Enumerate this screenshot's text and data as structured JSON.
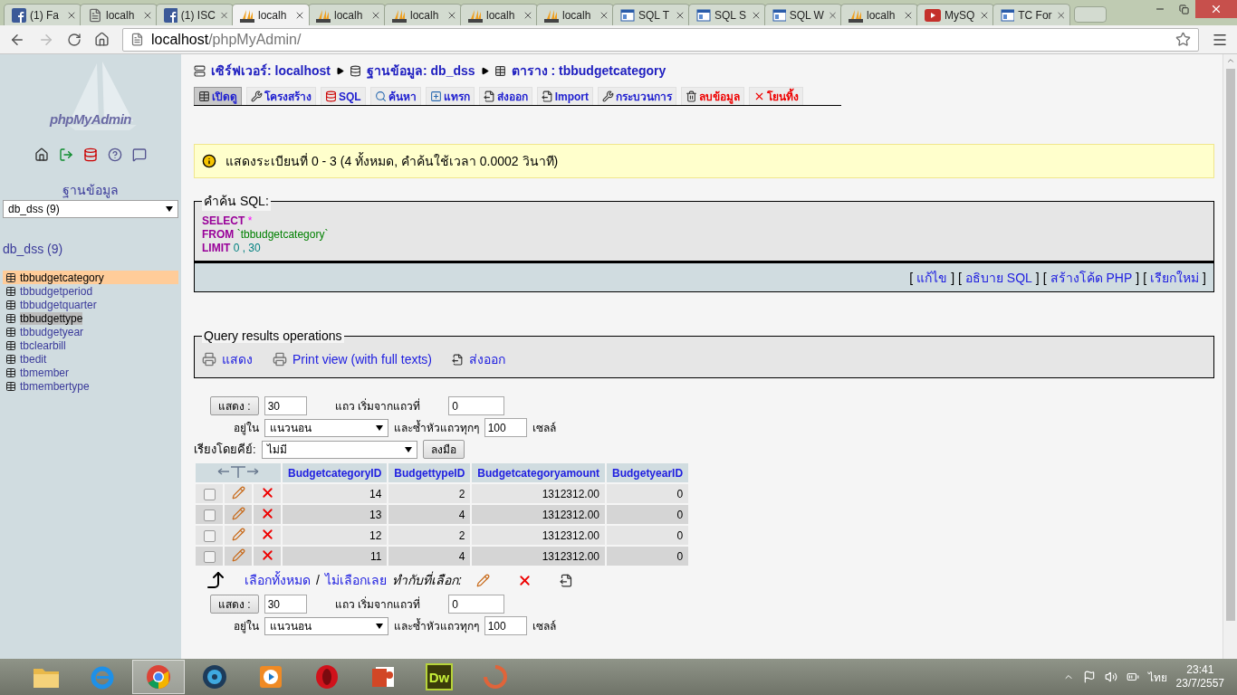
{
  "browser": {
    "tabs": [
      {
        "label": "(1) Fa",
        "kind": "facebook",
        "selected": false
      },
      {
        "label": "localh",
        "kind": "page",
        "selected": false
      },
      {
        "label": "(1) ISC",
        "kind": "facebook",
        "selected": false
      },
      {
        "label": "localh",
        "kind": "pma",
        "selected": true
      },
      {
        "label": "localh",
        "kind": "pma",
        "selected": false
      },
      {
        "label": "localh",
        "kind": "pma",
        "selected": false
      },
      {
        "label": "localh",
        "kind": "pma",
        "selected": false
      },
      {
        "label": "localh",
        "kind": "pma",
        "selected": false
      },
      {
        "label": "SQL T",
        "kind": "sql",
        "selected": false
      },
      {
        "label": "SQL S",
        "kind": "sql",
        "selected": false
      },
      {
        "label": "SQL W",
        "kind": "sql",
        "selected": false
      },
      {
        "label": "localh",
        "kind": "pma",
        "selected": false
      },
      {
        "label": "MySQ",
        "kind": "youtube",
        "selected": false
      },
      {
        "label": "TC For",
        "kind": "sql",
        "selected": false
      }
    ],
    "url_host": "localhost",
    "url_path": "/phpMyAdmin/"
  },
  "sidebar": {
    "logo": "phpMyAdmin",
    "db_label": "ฐานข้อมูล",
    "db_select": "db_dss (9)",
    "db_heading": "db_dss (9)",
    "tables": [
      {
        "name": "tbbudgetcategory",
        "selected": true,
        "hovered": false
      },
      {
        "name": "tbbudgetperiod",
        "selected": false,
        "hovered": false
      },
      {
        "name": "tbbudgetquarter",
        "selected": false,
        "hovered": false
      },
      {
        "name": "tbbudgettype",
        "selected": false,
        "hovered": true
      },
      {
        "name": "tbbudgetyear",
        "selected": false,
        "hovered": false
      },
      {
        "name": "tbclearbill",
        "selected": false,
        "hovered": false
      },
      {
        "name": "tbedit",
        "selected": false,
        "hovered": false
      },
      {
        "name": "tbmember",
        "selected": false,
        "hovered": false
      },
      {
        "name": "tbmembertype",
        "selected": false,
        "hovered": false
      }
    ]
  },
  "breadcrumb": [
    {
      "kind": "server",
      "label": "เซิร์ฟเวอร์: localhost"
    },
    {
      "kind": "database",
      "label": "ฐานข้อมูล: db_dss"
    },
    {
      "kind": "table",
      "label": "ตาราง : tbbudgetcategory"
    }
  ],
  "tabs": [
    {
      "label": "เปิดดู",
      "kind": "browse",
      "selected": true
    },
    {
      "label": "โครงสร้าง",
      "kind": "structure",
      "selected": false
    },
    {
      "label": "SQL",
      "kind": "sql",
      "selected": false
    },
    {
      "label": "ค้นหา",
      "kind": "search",
      "selected": false
    },
    {
      "label": "แทรก",
      "kind": "insert",
      "selected": false
    },
    {
      "label": "ส่งออก",
      "kind": "export",
      "selected": false
    },
    {
      "label": "Import",
      "kind": "import",
      "selected": false
    },
    {
      "label": "กระบวนการ",
      "kind": "tools",
      "selected": false
    },
    {
      "label": "ลบข้อมูล",
      "kind": "empty",
      "selected": false
    },
    {
      "label": "โยนทิ้ง",
      "kind": "drop",
      "selected": false
    }
  ],
  "notice": "แสดงระเบียนที่ 0 - 3 (4 ทั้งหมด, คำค้นใช้เวลา 0.0002 วินาที)",
  "sql_box": {
    "legend": "คำค้น SQL:",
    "lines": [
      {
        "keyword": "SELECT",
        "rest": "*",
        "kind": "symbol"
      },
      {
        "keyword": "FROM",
        "rest": "`tbbudgetcategory`",
        "kind": "string"
      },
      {
        "keyword": "LIMIT",
        "rest": "0 , 30",
        "kind": "number"
      }
    ],
    "bracket_open": "[",
    "bracket_close": "]",
    "links": [
      "แก้ไข",
      "อธิบาย SQL",
      "สร้างโค้ด PHP",
      "เรียกใหม่"
    ]
  },
  "operations": {
    "legend": "Query results operations",
    "links": [
      {
        "label": "แสดง",
        "kind": "print"
      },
      {
        "label": "Print view (with full texts)",
        "kind": "print"
      },
      {
        "label": "ส่งออก",
        "kind": "export"
      }
    ]
  },
  "nav_forms": [
    {
      "show_button": "แสดง :",
      "rows": "30",
      "rows_label": "แถว เริ่มจากแถวที่",
      "start": "0",
      "mode_label": "อยู่ใน",
      "mode": "แนวนอน",
      "repeat_label": "และซ้ำหัวแถวทุกๆ",
      "repeat": "100",
      "cells_label": "เซลล์"
    },
    {
      "show_button": "แสดง :",
      "rows": "30",
      "rows_label": "แถว เริ่มจากแถวที่",
      "start": "0",
      "mode_label": "อยู่ใน",
      "mode": "แนวนอน",
      "repeat_label": "และซ้ำหัวแถวทุกๆ",
      "repeat": "100",
      "cells_label": "เซลล์"
    }
  ],
  "sort": {
    "label": "เรียงโดยคีย์:",
    "value": "ไม่มี",
    "button": "ลงมือ"
  },
  "table": {
    "columns": [
      "BudgetcategoryID",
      "BudgettypeID",
      "Budgetcategoryamount",
      "BudgetyearID"
    ],
    "rows": [
      {
        "cells": [
          "14",
          "2",
          "1312312.00",
          "0"
        ],
        "checked": false
      },
      {
        "cells": [
          "13",
          "4",
          "1312312.00",
          "0"
        ],
        "checked": false
      },
      {
        "cells": [
          "12",
          "2",
          "1312312.00",
          "0"
        ],
        "checked": false
      },
      {
        "cells": [
          "11",
          "4",
          "1312312.00",
          "0"
        ],
        "checked": false
      }
    ]
  },
  "bulk": {
    "select_all": "เลือกทั้งหมด",
    "separator": "/",
    "select_none": "ไม่เลือกเลย",
    "with_selected": "ทำกับที่เลือก:"
  },
  "taskbar": {
    "apps": [
      {
        "kind": "folder",
        "selected": false
      },
      {
        "kind": "ie",
        "selected": false
      },
      {
        "kind": "chrome",
        "selected": true
      },
      {
        "kind": "disc",
        "selected": false
      },
      {
        "kind": "media",
        "selected": false
      },
      {
        "kind": "opera",
        "selected": false
      },
      {
        "kind": "powerpoint",
        "selected": false
      },
      {
        "kind": "dreamweaver",
        "label": "Dw",
        "selected": false
      },
      {
        "kind": "loader",
        "selected": false
      }
    ],
    "language": "ไทย",
    "time": "23:41",
    "date": "23/7/2557"
  }
}
